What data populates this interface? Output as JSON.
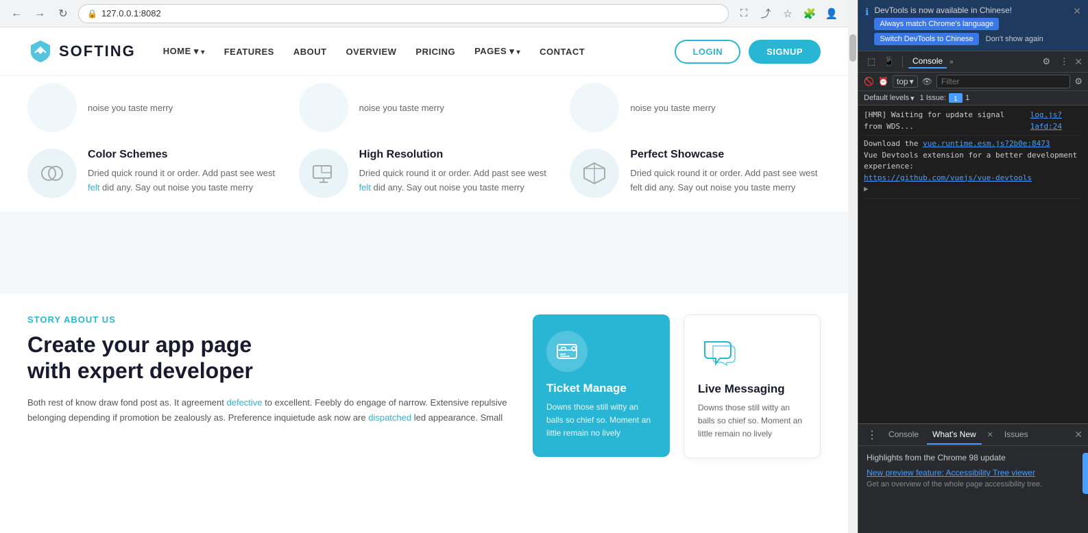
{
  "browser": {
    "back_label": "←",
    "forward_label": "→",
    "refresh_label": "↻",
    "address": "127.0.0.1:8082"
  },
  "navbar": {
    "logo_text": "SOFTING",
    "nav_items": [
      {
        "label": "HOME",
        "has_arrow": true
      },
      {
        "label": "FEATURES",
        "has_arrow": false
      },
      {
        "label": "ABOUT",
        "has_arrow": false
      },
      {
        "label": "OVERVIEW",
        "has_arrow": false
      },
      {
        "label": "PRICING",
        "has_arrow": false
      },
      {
        "label": "PAGES",
        "has_arrow": true
      },
      {
        "label": "CONTACT",
        "has_arrow": false
      }
    ],
    "login_label": "LOGIN",
    "signup_label": "SIGNUP"
  },
  "features_partial": {
    "description": "noise you taste merry"
  },
  "features": [
    {
      "title": "Color Schemes",
      "description": "Dried quick round it or order. Add past see west felt did any. Say out noise you taste merry",
      "highlight": "felt"
    },
    {
      "title": "High Resolution",
      "description": "Dried quick round it or order. Add past see west felt did any. Say out noise you taste merry",
      "highlight": "felt"
    },
    {
      "title": "Perfect Showcase",
      "description": "Dried quick round it or order. Add past see west felt did any. Say out noise you taste merry",
      "highlight": ""
    }
  ],
  "story": {
    "label": "STORY ABOUT US",
    "title_line1": "Create your app page",
    "title_line2": "with expert developer",
    "description": "Both rest of know draw fond post as. It agreement defective to excellent. Feebly do engage of narrow. Extensive repulsive belonging depending if promotion be zealously as. Preference inquietude ask now are dispatched led appearance. Small"
  },
  "cards": [
    {
      "type": "blue",
      "title": "Ticket Manage",
      "description": "Downs those still witty an balls so chief so. Moment an little remain no lively"
    },
    {
      "type": "white",
      "title": "Live Messaging",
      "description": "Downs those still witty an balls so chief so. Moment an little remain no lively"
    }
  ],
  "devtools": {
    "notification_text": "DevTools is now available in Chinese!",
    "btn_always_match": "Always match Chrome's language",
    "btn_switch": "Switch DevTools to Chinese",
    "btn_dont_show": "Don't show again",
    "tabs": {
      "console_label": "Console",
      "console_chevron": "»"
    },
    "filter": {
      "top_label": "top",
      "filter_placeholder": "Filter"
    },
    "levels": {
      "default_label": "Default levels",
      "issue_label": "1 Issue:",
      "issue_count": "1"
    },
    "log_hmr": "[HMR] Waiting for update signal from WDS...",
    "log_hmr_link": "log.js?1afd:24",
    "log_vue": "Download the",
    "log_vue_link": "vue.runtime.esm.js?2b0e:8473",
    "log_vue_text2": "Vue Devtools extension for a better development experience:",
    "log_vue_url": "https://github.com/vuejs/vue-devtools",
    "bottom_tabs": [
      "Console",
      "What's New",
      "Issues"
    ],
    "whats_new_title": "Highlights from the Chrome 98 update",
    "whats_new_link": "New preview feature: Accessibility Tree viewer",
    "whats_new_desc": "Get an overview of the whole page accessibility tree."
  }
}
